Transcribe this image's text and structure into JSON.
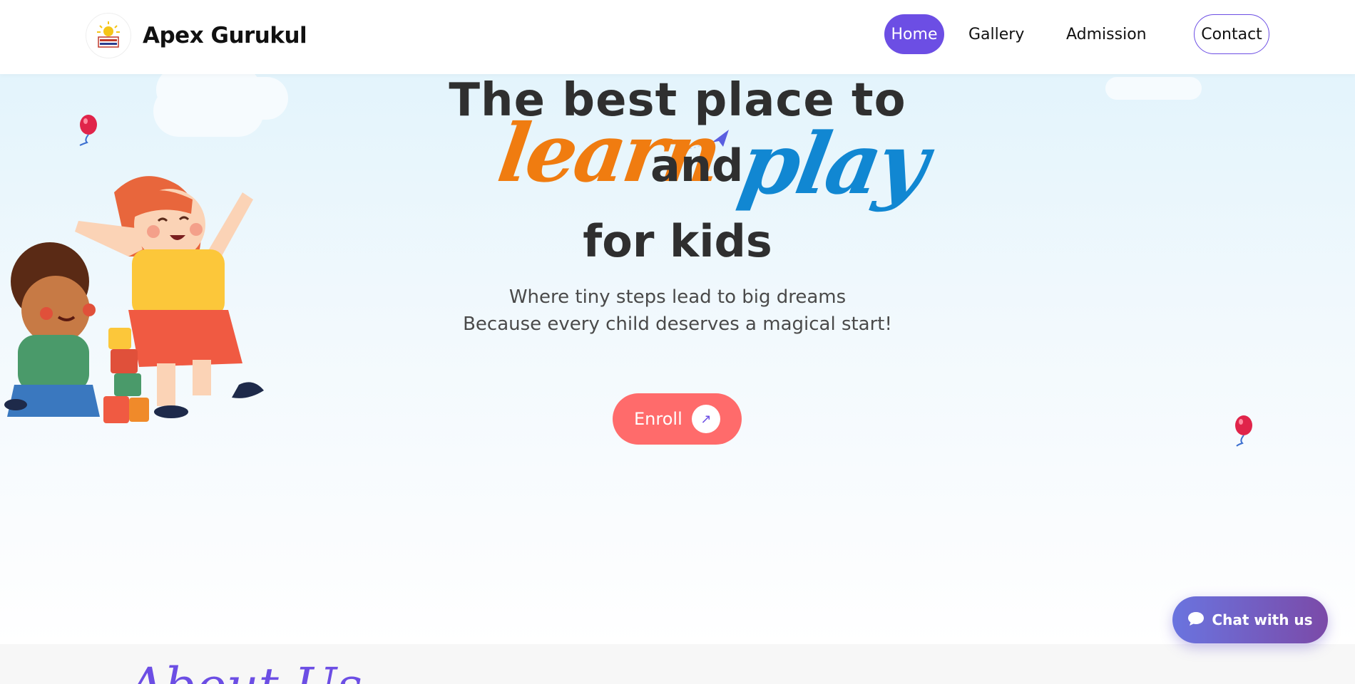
{
  "brand": {
    "name": "Apex Gurukul"
  },
  "nav": {
    "home": "Home",
    "gallery": "Gallery",
    "admission": "Admission",
    "contact": "Contact"
  },
  "hero": {
    "line1": "The best place to",
    "learn": "learn",
    "and": "and",
    "play": "play",
    "line3": "for kids",
    "sub1": "Where tiny steps lead to big dreams",
    "sub2": "Because every child deserves a magical start!",
    "enroll": "Enroll",
    "enroll_arrow": "↗"
  },
  "about": {
    "title": "About Us"
  },
  "chat": {
    "label": "Chat with us"
  },
  "colors": {
    "accent": "#6c4ee4",
    "learn": "#f07c10",
    "play": "#1187d2",
    "enroll": "#ff6b6b"
  },
  "icons": [
    "logo-icon",
    "paper-plane-icon",
    "balloon-icon",
    "children-illustration",
    "arrow-up-right-icon",
    "chat-bubble-icon"
  ]
}
